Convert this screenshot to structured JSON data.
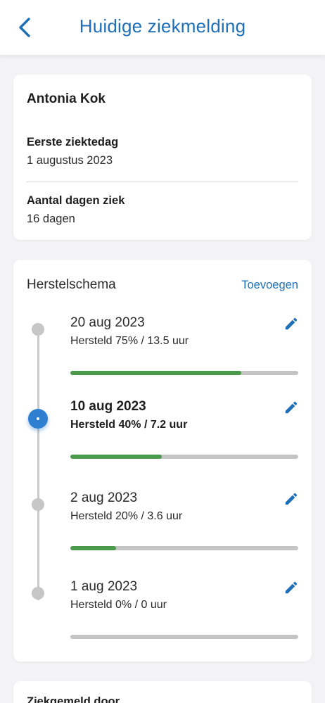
{
  "header": {
    "title": "Huidige ziekmelding",
    "back_icon": "chevron-left-icon"
  },
  "colors": {
    "accent": "#1e6fb8",
    "progress": "#4a9a4c",
    "track": "#c4c4c4",
    "active_dot": "#2f7fd0"
  },
  "info": {
    "name": "Antonia Kok",
    "first_day_label": "Eerste ziektedag",
    "first_day_value": "1 augustus 2023",
    "days_label": "Aantal dagen ziek",
    "days_value": "16 dagen"
  },
  "schema": {
    "title": "Herstelschema",
    "add_label": "Toevoegen",
    "entries": [
      {
        "date": "20 aug 2023",
        "detail": "Hersteld 75% / 13.5 uur",
        "progress": 0.75,
        "active": false
      },
      {
        "date": "10 aug 2023",
        "detail": "Hersteld 40% / 7.2 uur",
        "progress": 0.4,
        "active": true
      },
      {
        "date": "2 aug 2023",
        "detail": "Hersteld 20% / 3.6 uur",
        "progress": 0.2,
        "active": false
      },
      {
        "date": "1 aug 2023",
        "detail": "Hersteld 0% / 0 uur",
        "progress": 0.0,
        "active": false
      }
    ]
  },
  "next_card": {
    "label": "Ziekgemeld door"
  }
}
